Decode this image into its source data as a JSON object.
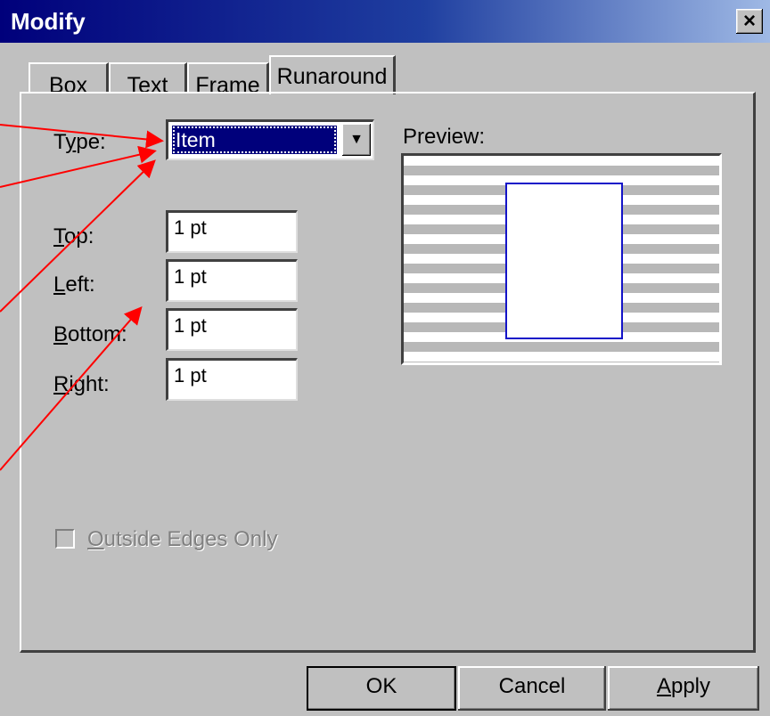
{
  "window": {
    "title": "Modify",
    "close_label": "×"
  },
  "tabs": [
    {
      "label": "Box",
      "active": false
    },
    {
      "label": "Text",
      "active": false
    },
    {
      "label": "Frame",
      "active": false
    },
    {
      "label": "Runaround",
      "active": true
    }
  ],
  "runaround": {
    "type_label_pre": "T",
    "type_label_u": "y",
    "type_label_post": "pe:",
    "type_value": "Item",
    "fields": [
      {
        "u": "T",
        "rest": "op:",
        "value": "1 pt"
      },
      {
        "u": "L",
        "rest": "eft:",
        "value": "1 pt"
      },
      {
        "u": "B",
        "rest": "ottom:",
        "value": "1 pt"
      },
      {
        "u": "R",
        "rest": "ight:",
        "value": "1 pt"
      }
    ],
    "preview_label": "Preview:",
    "checkbox_u": "O",
    "checkbox_rest": "utside Edges Only",
    "checkbox_checked": false,
    "checkbox_enabled": false
  },
  "buttons": {
    "ok": "OK",
    "cancel": "Cancel",
    "apply_u": "A",
    "apply_rest": "pply"
  },
  "colors": {
    "annotation_arrow": "#ff0000",
    "selection": "#00007b",
    "preview_item_border": "#1414c8"
  }
}
